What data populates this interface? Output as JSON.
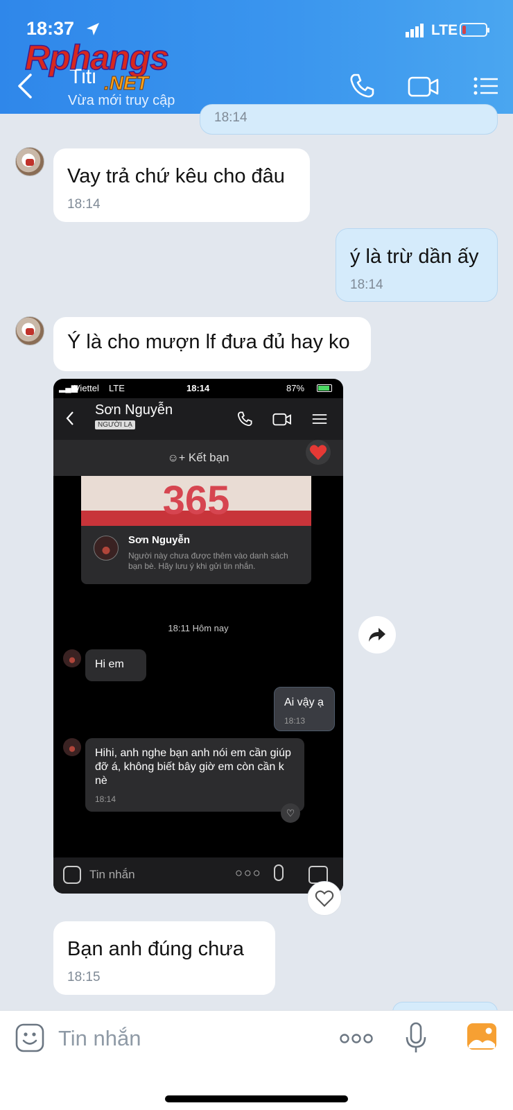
{
  "status_bar": {
    "time": "18:37",
    "network": "LTE"
  },
  "header": {
    "contact_name": "Titi",
    "contact_status": "Vừa mới truy cập"
  },
  "watermark": {
    "main": "Rphangs",
    "sub": ".NET"
  },
  "messages": [
    {
      "text": "",
      "time": "18:14"
    },
    {
      "text": "Vay trả chứ kêu cho đâu",
      "time": "18:14"
    },
    {
      "text": "ý là trừ dần ấy",
      "time": "18:14"
    },
    {
      "text": "Ý là cho mượn lf đưa đủ hay ko"
    },
    {
      "text": "Bạn anh đúng chưa",
      "time": "18:15"
    }
  ],
  "embedded": {
    "carrier": "Viettel",
    "network": "LTE",
    "time": "18:14",
    "battery": "87%",
    "contact_name": "Sơn Nguyễn",
    "stranger_badge": "NGƯỜI LẠ",
    "add_friend": "Kết bạn",
    "banner_text": "365",
    "card_name": "Sơn Nguyễn",
    "card_desc": "Người này chưa được thêm vào danh sách bạn bè. Hãy lưu ý khi gửi tin nhắn.",
    "divider": "18:11 Hôm nay",
    "msgs": [
      {
        "text": "Hi em"
      },
      {
        "text": "Ai vậy ạ",
        "time": "18:13"
      },
      {
        "text": "Hihi, anh nghe bạn anh nói em cần giúp đỡ á, không biết bây giờ em còn cần k nè",
        "time": "18:14"
      }
    ],
    "input_placeholder": "Tin nhắn"
  },
  "input": {
    "placeholder": "Tin nhắn"
  },
  "colors": {
    "header": "#3a95ee",
    "out_bubble": "#d5ebfb",
    "in_bubble": "#ffffff",
    "background": "#e2e7ee"
  }
}
